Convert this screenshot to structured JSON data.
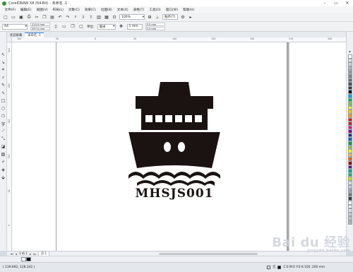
{
  "window": {
    "title": "CorelDRAW X8 (64-Bit) - 未命名 -1"
  },
  "menu": [
    "文件(F)",
    "编辑(E)",
    "视图(V)",
    "布局(L)",
    "对象(C)",
    "效果(C)",
    "位图(B)",
    "文本(X)",
    "表格(T)",
    "工具(O)",
    "窗口(W)",
    "帮助(H)"
  ],
  "toolbar": {
    "zoom": "100%",
    "snap": "贴齐(T)"
  },
  "property_bar": {
    "page_size": "A4",
    "width": "210.0 mm",
    "height": "297.0 mm",
    "unit_label": "单位:",
    "unit": "毫米",
    "nudge": "1 mm",
    "dup_x": "5.0 mm",
    "dup_y": "5.0 mm"
  },
  "tabs": [
    {
      "label": "欢迎屏幕",
      "active": false
    },
    {
      "label": "未命名 -1",
      "active": true
    }
  ],
  "ruler_top": [
    "100",
    "50",
    "0",
    "50",
    "100",
    "150",
    "200",
    "250",
    "300"
  ],
  "ruler_left": [
    "250",
    "200",
    "150",
    "100",
    "50",
    "0"
  ],
  "artwork": {
    "text": "MHSJS001",
    "fill": "#1a1311"
  },
  "page_nav": {
    "label": "1 的 1",
    "page_tab": "页 1"
  },
  "status": {
    "coords": "( 139.692, 128.242 )",
    "fill_label": "无",
    "outline": "C:0 M:0 Y:0 K:100 .200 mm"
  },
  "palette_colors": [
    "#ffffff",
    "#e6e6e6",
    "#cccccc",
    "#b3b3b3",
    "#999999",
    "#808080",
    "#666666",
    "#4d4d4d",
    "#333333",
    "#000000",
    "#00a0e9",
    "#00b050",
    "#7fc241",
    "#ffff00",
    "#ffc000",
    "#f39800",
    "#e60012",
    "#c1272d",
    "#e4007f",
    "#920783",
    "#1d2088",
    "#0068b7",
    "#009944",
    "#8fc31f",
    "#fff100",
    "#f8b551",
    "#eb6100",
    "#a40000",
    "#601986",
    "#00a29a",
    "#13ae67",
    "#cfdb00",
    "#dcdddd",
    "#c9caca",
    "#9fa0a0",
    "#727171",
    "#3e3a39",
    "#ffffff",
    "#f0f0f0",
    "#e0e0e0",
    "#d0d0d0",
    "#c0c0c0",
    "#b0b0b0"
  ],
  "bottom_colors": [
    "#ffffff",
    "#000000"
  ],
  "watermark": {
    "text": "Bai du 经验",
    "sub": "jingyan.baidu.com"
  }
}
